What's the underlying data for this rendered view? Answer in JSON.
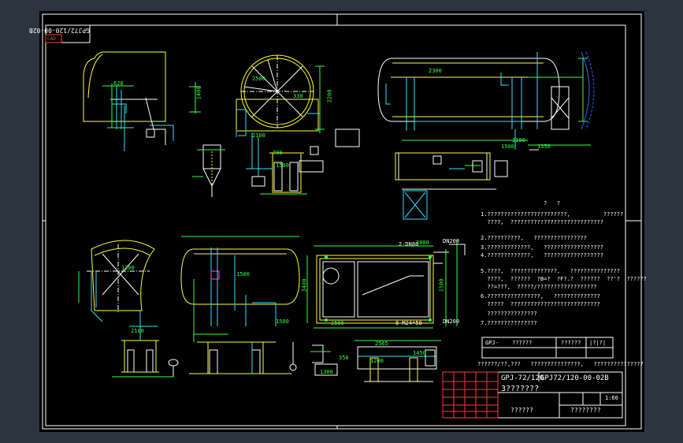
{
  "drawing": {
    "drawing_code": "GPJ72/120-00-02B",
    "title_short": "GPJ-72/120",
    "title_code": "GPJ72/120-00-02B",
    "title_line2": "3???????",
    "title_line3": "??????",
    "title_line4": "????????",
    "scale": "1:60",
    "logo_text": "CAD"
  },
  "notes": {
    "heading": "?   ?",
    "lines": [
      "1.????????????????????????,          ??????",
      "  ????,  ????????????????????????????",
      "2.??????????,   ????????????????",
      "3.?????????????,   ??????????????????",
      "4.?????????????,   ??????????????????",
      "5.????,  ??????????????,   ???????????????",
      "  ????,  ??????  ?B=?  ?F?.?  ??????  ??'?  ??????",
      "  ??=???,  ?????/??????????????????",
      "6.????????????????,   ??????????????",
      "  ?????  ???????????????????????????",
      "  ???????????????",
      "7.???????????????"
    ],
    "table_cells": [
      "GPJ-",
      "??????",
      "??????",
      "|?|?|"
    ],
    "footer": "??????/??,???   ???????????????,   ???????????????"
  },
  "dimensions": {
    "d620": "620",
    "d1400": "1400",
    "d2500": "2500",
    "d2100": "2100",
    "d1500": "1500",
    "d2200": "2200",
    "d700": "700",
    "d330": "330",
    "d2300": "2300",
    "d1500b": "1500",
    "d2100b": "2100",
    "d1350": "1350",
    "d1300": "1300",
    "d1500c": "1500",
    "d2565": "2565",
    "d2565b": "2565",
    "d3400": "3400",
    "d1300b": "1300",
    "dn80": "2-DN80",
    "dn200a": "DN200",
    "dn200b": "DN200",
    "m24": "8-M24*50",
    "d1500d": "1500",
    "d1450": "1450",
    "d1200": "1200",
    "d350": "350",
    "d2880": "2880",
    "d2100c": "2100",
    "d1500e": "1500"
  },
  "colors": {
    "background": "#2b3540",
    "sheet": "#000000",
    "frame": "#ffffff",
    "outline": "#ffff33",
    "pipe": "#33e0ff",
    "dim": "#33ff44",
    "title_block": "#ff3b3b"
  }
}
